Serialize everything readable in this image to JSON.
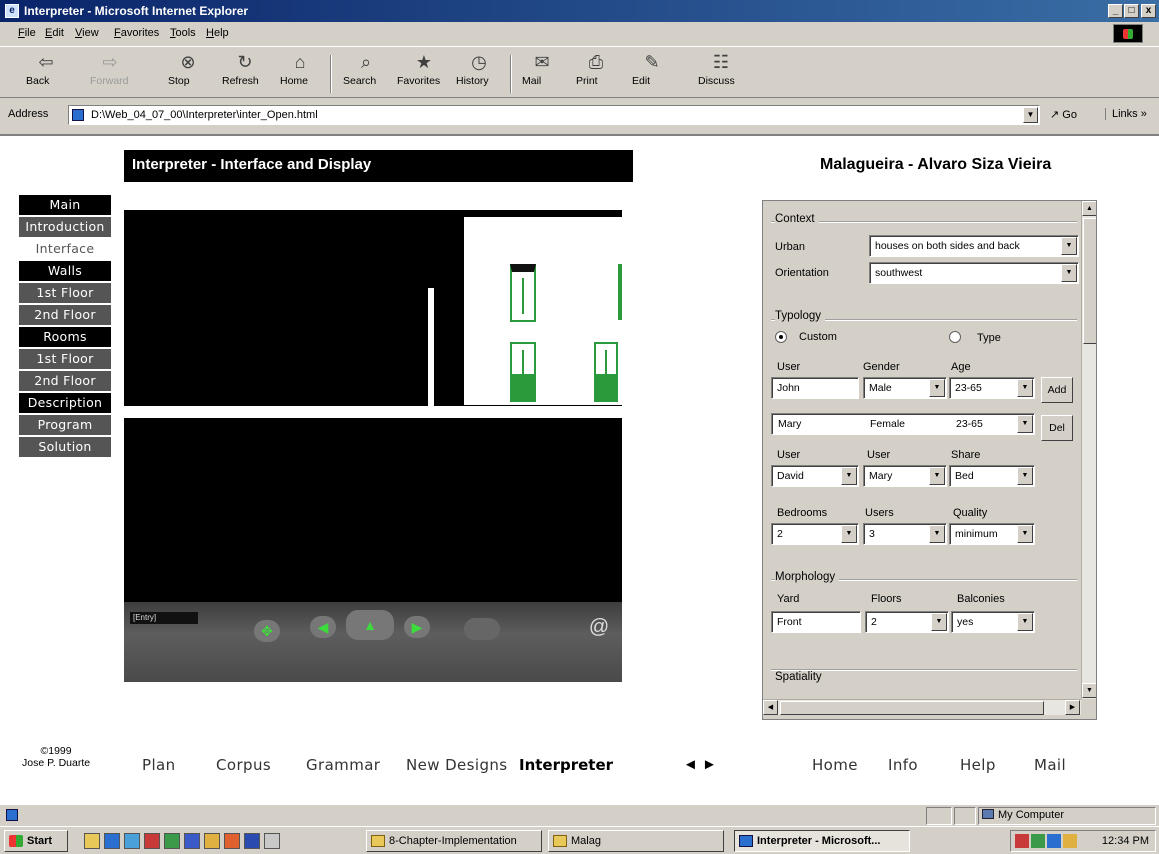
{
  "window": {
    "title": "Interpreter - Microsoft Internet Explorer",
    "minimize": "_",
    "maximize": "□",
    "close": "x"
  },
  "menu": [
    "File",
    "Edit",
    "View",
    "Favorites",
    "Tools",
    "Help"
  ],
  "toolbar": [
    {
      "label": "Back",
      "icon": "back-arrow-icon",
      "glyph": "⇦"
    },
    {
      "label": "Forward",
      "icon": "forward-arrow-icon",
      "glyph": "⇨"
    },
    {
      "label": "Stop",
      "icon": "stop-icon",
      "glyph": "⊗"
    },
    {
      "label": "Refresh",
      "icon": "refresh-icon",
      "glyph": "↻"
    },
    {
      "label": "Home",
      "icon": "home-icon",
      "glyph": "⌂"
    },
    {
      "label": "Search",
      "icon": "search-icon",
      "glyph": "⌕"
    },
    {
      "label": "Favorites",
      "icon": "favorites-icon",
      "glyph": "★"
    },
    {
      "label": "History",
      "icon": "history-icon",
      "glyph": "◷"
    },
    {
      "label": "Mail",
      "icon": "mail-icon",
      "glyph": "✉"
    },
    {
      "label": "Print",
      "icon": "print-icon",
      "glyph": "⎙"
    },
    {
      "label": "Edit",
      "icon": "edit-icon",
      "glyph": "✎"
    },
    {
      "label": "Discuss",
      "icon": "discuss-icon",
      "glyph": "☷"
    }
  ],
  "address": {
    "label": "Address",
    "url": "D:\\Web_04_07_00\\Interpreter\\inter_Open.html",
    "go": "Go",
    "links": "Links »"
  },
  "page": {
    "header": "Interpreter - Interface and Display",
    "subtitle": "Malagueira - Alvaro Siza Vieira"
  },
  "sidenav": [
    {
      "label": "Main",
      "kind": "section"
    },
    {
      "label": "Introduction",
      "kind": "link"
    },
    {
      "label": "Interface",
      "kind": "current"
    },
    {
      "label": "Walls",
      "kind": "section"
    },
    {
      "label": "1st Floor",
      "kind": "link"
    },
    {
      "label": "2nd Floor",
      "kind": "link"
    },
    {
      "label": "Rooms",
      "kind": "section"
    },
    {
      "label": "1st Floor",
      "kind": "link"
    },
    {
      "label": "2nd Floor",
      "kind": "link"
    },
    {
      "label": "Description",
      "kind": "section"
    },
    {
      "label": "Program",
      "kind": "link"
    },
    {
      "label": "Solution",
      "kind": "link"
    }
  ],
  "viewer": {
    "entry_label": "[Entry]"
  },
  "form": {
    "context": {
      "title": "Context",
      "urban_label": "Urban",
      "urban_value": "houses on both sides and back",
      "orientation_label": "Orientation",
      "orientation_value": "southwest"
    },
    "typology": {
      "title": "Typology",
      "custom_label": "Custom",
      "type_label": "Type",
      "user_header": "User",
      "gender_header": "Gender",
      "age_header": "Age",
      "users": [
        {
          "name": "John",
          "gender": "Male",
          "age": "23-65"
        },
        {
          "name": "Mary",
          "gender": "Female",
          "age": "23-65"
        }
      ],
      "add_button": "Add",
      "del_button": "Del",
      "share_user1_header": "User",
      "share_user2_header": "User",
      "share_header": "Share",
      "share": {
        "user1": "David",
        "user2": "Mary",
        "share": "Bed"
      },
      "bedrooms_header": "Bedrooms",
      "users_header": "Users",
      "quality_header": "Quality",
      "bedrooms": "2",
      "users_count": "3",
      "quality": "minimum"
    },
    "morphology": {
      "title": "Morphology",
      "yard_header": "Yard",
      "floors_header": "Floors",
      "balconies_header": "Balconies",
      "yard": "Front",
      "floors": "2",
      "balconies": "yes"
    },
    "spatiality": {
      "title": "Spatiality"
    }
  },
  "footer": {
    "copyright_line1": "©1999",
    "copyright_line2": "Jose P. Duarte",
    "links": [
      "Plan",
      "Corpus",
      "Grammar",
      "New Designs",
      "Interpreter"
    ],
    "current": "Interpreter",
    "arrows": "◄ ►",
    "right_links": [
      "Home",
      "Info",
      "Help",
      "Mail"
    ]
  },
  "statusbar": {
    "zone": "My Computer"
  },
  "taskbar": {
    "start": "Start",
    "tasks": [
      {
        "label": "8-Chapter-Implementation",
        "active": false
      },
      {
        "label": "Malag",
        "active": false
      },
      {
        "label": "Interpreter - Microsoft...",
        "active": true
      }
    ],
    "clock": "12:34 PM"
  }
}
